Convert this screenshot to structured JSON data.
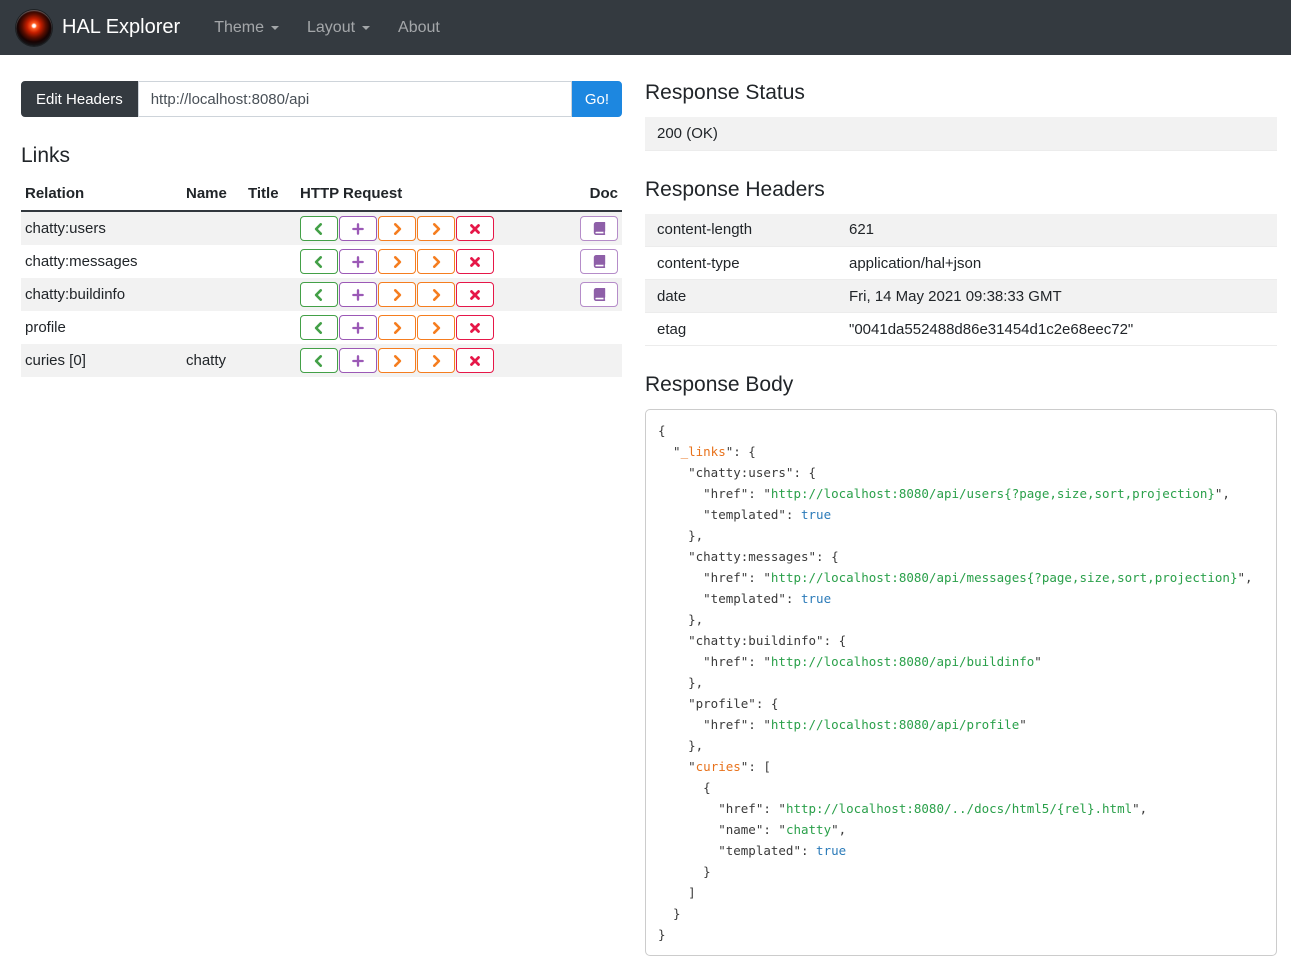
{
  "navbar": {
    "brand": "HAL Explorer",
    "items": [
      {
        "label": "Theme",
        "slug": "theme",
        "dropdown": true
      },
      {
        "label": "Layout",
        "slug": "layout",
        "dropdown": true
      },
      {
        "label": "About",
        "slug": "about",
        "dropdown": false
      }
    ]
  },
  "request_bar": {
    "edit_headers_label": "Edit Headers",
    "url_value": "http://localhost:8080/api",
    "go_label": "Go!"
  },
  "links": {
    "heading": "Links",
    "columns": [
      "Relation",
      "Name",
      "Title",
      "HTTP Request",
      "Doc"
    ],
    "http_buttons": [
      {
        "name": "get-button",
        "icon": "chevron-left-icon",
        "color": "#43a047"
      },
      {
        "name": "post-button",
        "icon": "plus-icon",
        "color": "#9b59b6"
      },
      {
        "name": "put-button",
        "icon": "chevron-right-icon",
        "color": "#f57d1f"
      },
      {
        "name": "patch-button",
        "icon": "chevron-right-icon",
        "color": "#f57d1f"
      },
      {
        "name": "delete-button",
        "icon": "x-icon",
        "color": "#e61748"
      }
    ],
    "doc_button": {
      "border_color": "#b58cc9",
      "icon_color": "#8e5fa8"
    },
    "rows": [
      {
        "relation": "chatty:users",
        "name": "",
        "title": "",
        "doc": true
      },
      {
        "relation": "chatty:messages",
        "name": "",
        "title": "",
        "doc": true
      },
      {
        "relation": "chatty:buildinfo",
        "name": "",
        "title": "",
        "doc": true
      },
      {
        "relation": "profile",
        "name": "",
        "title": "",
        "doc": false
      },
      {
        "relation": "curies [0]",
        "name": "chatty",
        "title": "",
        "doc": false
      }
    ]
  },
  "response": {
    "status_heading": "Response Status",
    "status": "200 (OK)",
    "headers_heading": "Response Headers",
    "headers": [
      {
        "name": "content-length",
        "value": "621"
      },
      {
        "name": "content-type",
        "value": "application/hal+json"
      },
      {
        "name": "date",
        "value": "Fri, 14 May 2021 09:38:33 GMT"
      },
      {
        "name": "etag",
        "value": "\"0041da552488d86e31454d1c2e68eec72\""
      }
    ],
    "body_heading": "Response Body",
    "body_lines": [
      [
        [
          "p",
          "{"
        ]
      ],
      [
        [
          "p",
          "  \""
        ],
        [
          "o",
          "_links"
        ],
        [
          "p",
          "\": {"
        ]
      ],
      [
        [
          "p",
          "    \"chatty:users\": {"
        ]
      ],
      [
        [
          "p",
          "      \"href\": \""
        ],
        [
          "s",
          "http://localhost:8080/api/users{?page,size,sort,projection}"
        ],
        [
          "p",
          "\","
        ]
      ],
      [
        [
          "p",
          "      \"templated\": "
        ],
        [
          "b",
          "true"
        ]
      ],
      [
        [
          "p",
          "    },"
        ]
      ],
      [
        [
          "p",
          "    \"chatty:messages\": {"
        ]
      ],
      [
        [
          "p",
          "      \"href\": \""
        ],
        [
          "s",
          "http://localhost:8080/api/messages{?page,size,sort,projection}"
        ],
        [
          "p",
          "\","
        ]
      ],
      [
        [
          "p",
          "      \"templated\": "
        ],
        [
          "b",
          "true"
        ]
      ],
      [
        [
          "p",
          "    },"
        ]
      ],
      [
        [
          "p",
          "    \"chatty:buildinfo\": {"
        ]
      ],
      [
        [
          "p",
          "      \"href\": \""
        ],
        [
          "s",
          "http://localhost:8080/api/buildinfo"
        ],
        [
          "p",
          "\""
        ]
      ],
      [
        [
          "p",
          "    },"
        ]
      ],
      [
        [
          "p",
          "    \"profile\": {"
        ]
      ],
      [
        [
          "p",
          "      \"href\": \""
        ],
        [
          "s",
          "http://localhost:8080/api/profile"
        ],
        [
          "p",
          "\""
        ]
      ],
      [
        [
          "p",
          "    },"
        ]
      ],
      [
        [
          "p",
          "    \""
        ],
        [
          "o",
          "curies"
        ],
        [
          "p",
          "\": ["
        ]
      ],
      [
        [
          "p",
          "      {"
        ]
      ],
      [
        [
          "p",
          "        \"href\": \""
        ],
        [
          "s",
          "http://localhost:8080/../docs/html5/{rel}.html"
        ],
        [
          "p",
          "\","
        ]
      ],
      [
        [
          "p",
          "        \"name\": \""
        ],
        [
          "s",
          "chatty"
        ],
        [
          "p",
          "\","
        ]
      ],
      [
        [
          "p",
          "        \"templated\": "
        ],
        [
          "b",
          "true"
        ]
      ],
      [
        [
          "p",
          "      }"
        ]
      ],
      [
        [
          "p",
          "    ]"
        ]
      ],
      [
        [
          "p",
          "  }"
        ]
      ],
      [
        [
          "p",
          "}"
        ]
      ]
    ]
  },
  "colors": {
    "navbar_bg": "#343a40",
    "accent_blue": "#1d87e0",
    "get_green": "#43a047",
    "post_purple": "#9b59b6",
    "put_patch_orange": "#f57d1f",
    "delete_red": "#e61748",
    "doc_purple": "#8e5fa8",
    "stripe_gray": "#f2f2f2",
    "json_key_orange": "#e8721c",
    "json_string_green": "#2aa04a",
    "json_bool_blue": "#2b7bb9"
  }
}
